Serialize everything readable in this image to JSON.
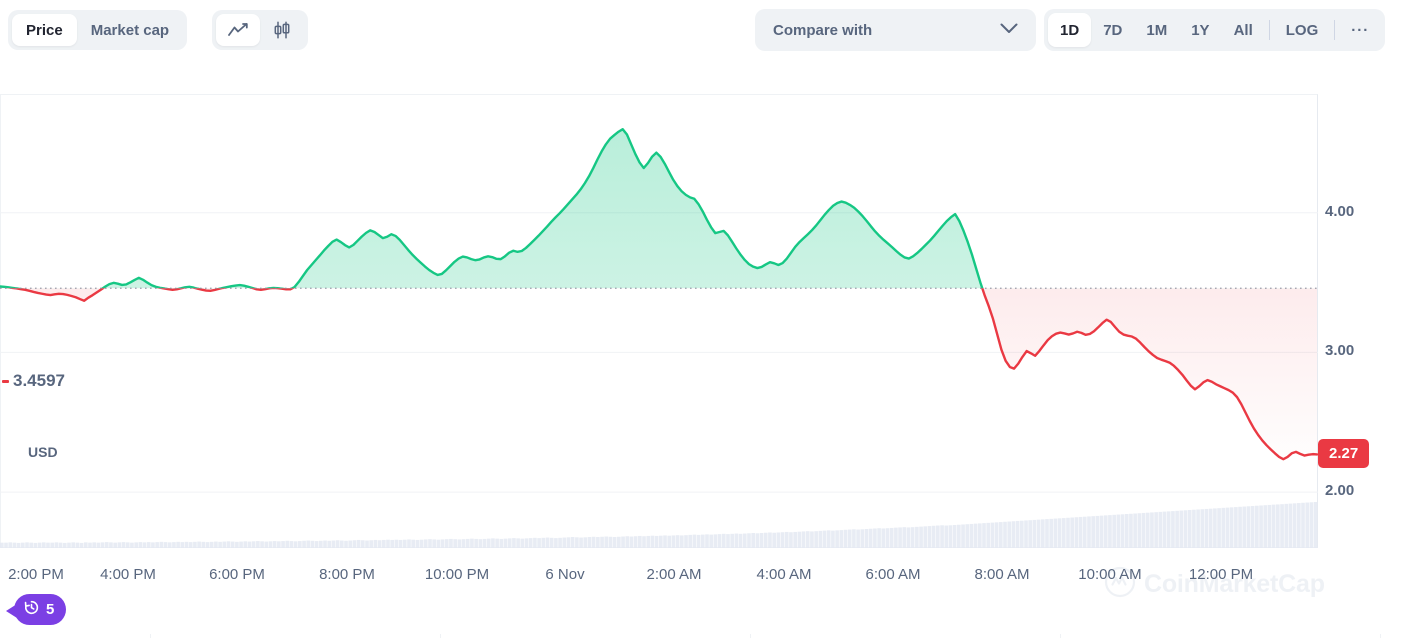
{
  "toolbar": {
    "metric_tabs": [
      {
        "label": "Price",
        "active": true
      },
      {
        "label": "Market cap",
        "active": false
      }
    ],
    "chart_type_tabs": [
      {
        "icon": "line-chart-icon",
        "active": true
      },
      {
        "icon": "candlestick-chart-icon",
        "active": false
      }
    ],
    "compare": {
      "label": "Compare with",
      "chevron": "chevron-down-icon"
    },
    "ranges": [
      {
        "label": "1D",
        "active": true
      },
      {
        "label": "7D",
        "active": false
      },
      {
        "label": "1M",
        "active": false
      },
      {
        "label": "1Y",
        "active": false
      },
      {
        "label": "All",
        "active": false
      }
    ],
    "log_label": "LOG",
    "more_label": "···"
  },
  "chart_data": {
    "type": "area",
    "title": "",
    "xlabel": "",
    "ylabel": "USD",
    "currency": "USD",
    "ylim": [
      1.6,
      4.85
    ],
    "y_ticks": [
      {
        "label": "4.00",
        "value": 4.0
      },
      {
        "label": "3.00",
        "value": 3.0
      },
      {
        "label": "2.00",
        "value": 2.0
      }
    ],
    "x_ticks": [
      {
        "label": "2:00 PM",
        "pos": 36
      },
      {
        "label": "4:00 PM",
        "pos": 128
      },
      {
        "label": "6:00 PM",
        "pos": 237
      },
      {
        "label": "8:00 PM",
        "pos": 347
      },
      {
        "label": "10:00 PM",
        "pos": 457
      },
      {
        "label": "6 Nov",
        "pos": 565
      },
      {
        "label": "2:00 AM",
        "pos": 674
      },
      {
        "label": "4:00 AM",
        "pos": 784
      },
      {
        "label": "6:00 AM",
        "pos": 893
      },
      {
        "label": "8:00 AM",
        "pos": 1002
      },
      {
        "label": "10:00 AM",
        "pos": 1110
      },
      {
        "label": "12:00 PM",
        "pos": 1221
      }
    ],
    "baseline": {
      "label": "3.4597",
      "value": 3.4597
    },
    "last_price": {
      "label": "2.27",
      "value": 2.27
    },
    "colors": {
      "up": "#16c784",
      "down": "#ea3943",
      "grid": "#f0f2f5",
      "text": "#58667e",
      "volume": "#e4e9f2",
      "badge": "#7b3fe4"
    },
    "grid": true,
    "legend": "none",
    "prices": [
      3.472,
      3.47,
      3.466,
      3.462,
      3.458,
      3.453,
      3.448,
      3.441,
      3.433,
      3.426,
      3.42,
      3.414,
      3.411,
      3.416,
      3.42,
      3.418,
      3.412,
      3.404,
      3.395,
      3.382,
      3.37,
      3.392,
      3.41,
      3.43,
      3.45,
      3.471,
      3.489,
      3.498,
      3.492,
      3.483,
      3.487,
      3.502,
      3.519,
      3.534,
      3.52,
      3.5,
      3.482,
      3.47,
      3.463,
      3.458,
      3.453,
      3.448,
      3.452,
      3.459,
      3.466,
      3.47,
      3.464,
      3.456,
      3.449,
      3.443,
      3.441,
      3.447,
      3.455,
      3.462,
      3.468,
      3.474,
      3.479,
      3.482,
      3.478,
      3.47,
      3.461,
      3.452,
      3.448,
      3.453,
      3.459,
      3.462,
      3.46,
      3.456,
      3.452,
      3.452,
      3.468,
      3.505,
      3.548,
      3.59,
      3.625,
      3.66,
      3.694,
      3.73,
      3.762,
      3.792,
      3.808,
      3.79,
      3.768,
      3.752,
      3.77,
      3.8,
      3.83,
      3.856,
      3.874,
      3.862,
      3.84,
      3.818,
      3.828,
      3.846,
      3.834,
      3.806,
      3.77,
      3.734,
      3.7,
      3.67,
      3.642,
      3.615,
      3.59,
      3.57,
      3.555,
      3.562,
      3.588,
      3.618,
      3.648,
      3.672,
      3.686,
      3.68,
      3.668,
      3.66,
      3.666,
      3.68,
      3.688,
      3.682,
      3.67,
      3.668,
      3.688,
      3.714,
      3.728,
      3.72,
      3.726,
      3.748,
      3.776,
      3.806,
      3.836,
      3.868,
      3.9,
      3.934,
      3.966,
      3.996,
      4.028,
      4.062,
      4.096,
      4.13,
      4.168,
      4.212,
      4.262,
      4.32,
      4.382,
      4.44,
      4.49,
      4.53,
      4.556,
      4.58,
      4.598,
      4.56,
      4.49,
      4.42,
      4.36,
      4.32,
      4.356,
      4.402,
      4.43,
      4.4,
      4.35,
      4.292,
      4.236,
      4.19,
      4.154,
      4.128,
      4.11,
      4.1,
      4.062,
      4.01,
      3.95,
      3.896,
      3.854,
      3.862,
      3.87,
      3.838,
      3.792,
      3.744,
      3.7,
      3.662,
      3.632,
      3.614,
      3.604,
      3.612,
      3.63,
      3.646,
      3.638,
      3.626,
      3.64,
      3.672,
      3.714,
      3.756,
      3.79,
      3.818,
      3.846,
      3.876,
      3.91,
      3.948,
      3.986,
      4.02,
      4.05,
      4.07,
      4.08,
      4.072,
      4.056,
      4.036,
      4.008,
      3.976,
      3.94,
      3.902,
      3.866,
      3.834,
      3.806,
      3.78,
      3.754,
      3.726,
      3.7,
      3.68,
      3.672,
      3.688,
      3.712,
      3.74,
      3.77,
      3.8,
      3.834,
      3.87,
      3.906,
      3.94,
      3.968,
      3.99,
      3.94,
      3.87,
      3.79,
      3.7,
      3.6,
      3.5,
      3.41,
      3.33,
      3.24,
      3.13,
      3.02,
      2.94,
      2.896,
      2.884,
      2.92,
      2.968,
      3.01,
      2.994,
      2.976,
      3.01,
      3.05,
      3.088,
      3.116,
      3.134,
      3.142,
      3.136,
      3.128,
      3.136,
      3.148,
      3.14,
      3.126,
      3.132,
      3.152,
      3.18,
      3.21,
      3.234,
      3.218,
      3.182,
      3.148,
      3.128,
      3.12,
      3.114,
      3.098,
      3.07,
      3.038,
      3.008,
      2.982,
      2.96,
      2.948,
      2.938,
      2.926,
      2.904,
      2.874,
      2.84,
      2.8,
      2.762,
      2.736,
      2.758,
      2.786,
      2.802,
      2.79,
      2.772,
      2.758,
      2.744,
      2.73,
      2.712,
      2.68,
      2.63,
      2.57,
      2.51,
      2.456,
      2.41,
      2.37,
      2.336,
      2.306,
      2.278,
      2.252,
      2.236,
      2.252,
      2.278,
      2.288,
      2.274,
      2.262,
      2.268,
      2.272,
      2.27
    ],
    "volumes": [
      0.2,
      0.2,
      0.21,
      0.2,
      0.19,
      0.2,
      0.21,
      0.2,
      0.19,
      0.2,
      0.21,
      0.2,
      0.2,
      0.21,
      0.2,
      0.19,
      0.2,
      0.21,
      0.2,
      0.19,
      0.21,
      0.2,
      0.21,
      0.2,
      0.21,
      0.22,
      0.21,
      0.2,
      0.21,
      0.22,
      0.21,
      0.2,
      0.21,
      0.22,
      0.21,
      0.22,
      0.21,
      0.22,
      0.23,
      0.22,
      0.21,
      0.22,
      0.23,
      0.22,
      0.23,
      0.22,
      0.23,
      0.24,
      0.23,
      0.22,
      0.23,
      0.24,
      0.23,
      0.24,
      0.25,
      0.24,
      0.23,
      0.24,
      0.25,
      0.24,
      0.25,
      0.26,
      0.25,
      0.24,
      0.25,
      0.26,
      0.25,
      0.26,
      0.27,
      0.26,
      0.25,
      0.26,
      0.27,
      0.28,
      0.27,
      0.26,
      0.27,
      0.28,
      0.27,
      0.28,
      0.29,
      0.28,
      0.27,
      0.28,
      0.29,
      0.3,
      0.29,
      0.28,
      0.29,
      0.3,
      0.29,
      0.3,
      0.31,
      0.3,
      0.31,
      0.3,
      0.31,
      0.32,
      0.31,
      0.3,
      0.31,
      0.32,
      0.33,
      0.32,
      0.31,
      0.32,
      0.33,
      0.34,
      0.33,
      0.32,
      0.33,
      0.34,
      0.35,
      0.34,
      0.33,
      0.34,
      0.35,
      0.36,
      0.35,
      0.34,
      0.35,
      0.36,
      0.37,
      0.36,
      0.35,
      0.36,
      0.37,
      0.38,
      0.37,
      0.38,
      0.39,
      0.38,
      0.37,
      0.38,
      0.39,
      0.4,
      0.41,
      0.4,
      0.39,
      0.4,
      0.41,
      0.42,
      0.41,
      0.42,
      0.43,
      0.42,
      0.41,
      0.42,
      0.43,
      0.44,
      0.43,
      0.44,
      0.45,
      0.44,
      0.45,
      0.46,
      0.45,
      0.46,
      0.47,
      0.46,
      0.47,
      0.48,
      0.47,
      0.48,
      0.49,
      0.5,
      0.49,
      0.5,
      0.51,
      0.5,
      0.51,
      0.52,
      0.53,
      0.52,
      0.53,
      0.54,
      0.53,
      0.54,
      0.55,
      0.56,
      0.55,
      0.56,
      0.57,
      0.58,
      0.57,
      0.58,
      0.59,
      0.6,
      0.59,
      0.6,
      0.61,
      0.62,
      0.63,
      0.62,
      0.63,
      0.64,
      0.65,
      0.66,
      0.65,
      0.66,
      0.67,
      0.68,
      0.69,
      0.7,
      0.69,
      0.7,
      0.71,
      0.72,
      0.73,
      0.74,
      0.73,
      0.74,
      0.75,
      0.76,
      0.77,
      0.78,
      0.77,
      0.78,
      0.79,
      0.8,
      0.81,
      0.82,
      0.83,
      0.84,
      0.85,
      0.84,
      0.85,
      0.86,
      0.87,
      0.88,
      0.89,
      0.9,
      0.91,
      0.92,
      0.93,
      0.94,
      0.95,
      0.96,
      0.97,
      0.98,
      0.99,
      1.0,
      1.01,
      1.02,
      1.03,
      1.04,
      1.05,
      1.06,
      1.07,
      1.08,
      1.09,
      1.1,
      1.11,
      1.12,
      1.13,
      1.14,
      1.15,
      1.16,
      1.17,
      1.18,
      1.19,
      1.2,
      1.21,
      1.22,
      1.23,
      1.24,
      1.25,
      1.26,
      1.27,
      1.28,
      1.29,
      1.3,
      1.31,
      1.32,
      1.33,
      1.34,
      1.35,
      1.36,
      1.37,
      1.38,
      1.39,
      1.4,
      1.41,
      1.42,
      1.43,
      1.44,
      1.45,
      1.46,
      1.47,
      1.48,
      1.49,
      1.5,
      1.51,
      1.52,
      1.53,
      1.54,
      1.55,
      1.56,
      1.57,
      1.58,
      1.59,
      1.6,
      1.61,
      1.62,
      1.63,
      1.64,
      1.65,
      1.66,
      1.67,
      1.68,
      1.69,
      1.7,
      1.71,
      1.72
    ]
  },
  "watermark": {
    "text": "CoinMarketCap",
    "icon": "cmc-logo-icon"
  },
  "history_badge": {
    "count": "5",
    "icon": "history-clock-icon"
  }
}
